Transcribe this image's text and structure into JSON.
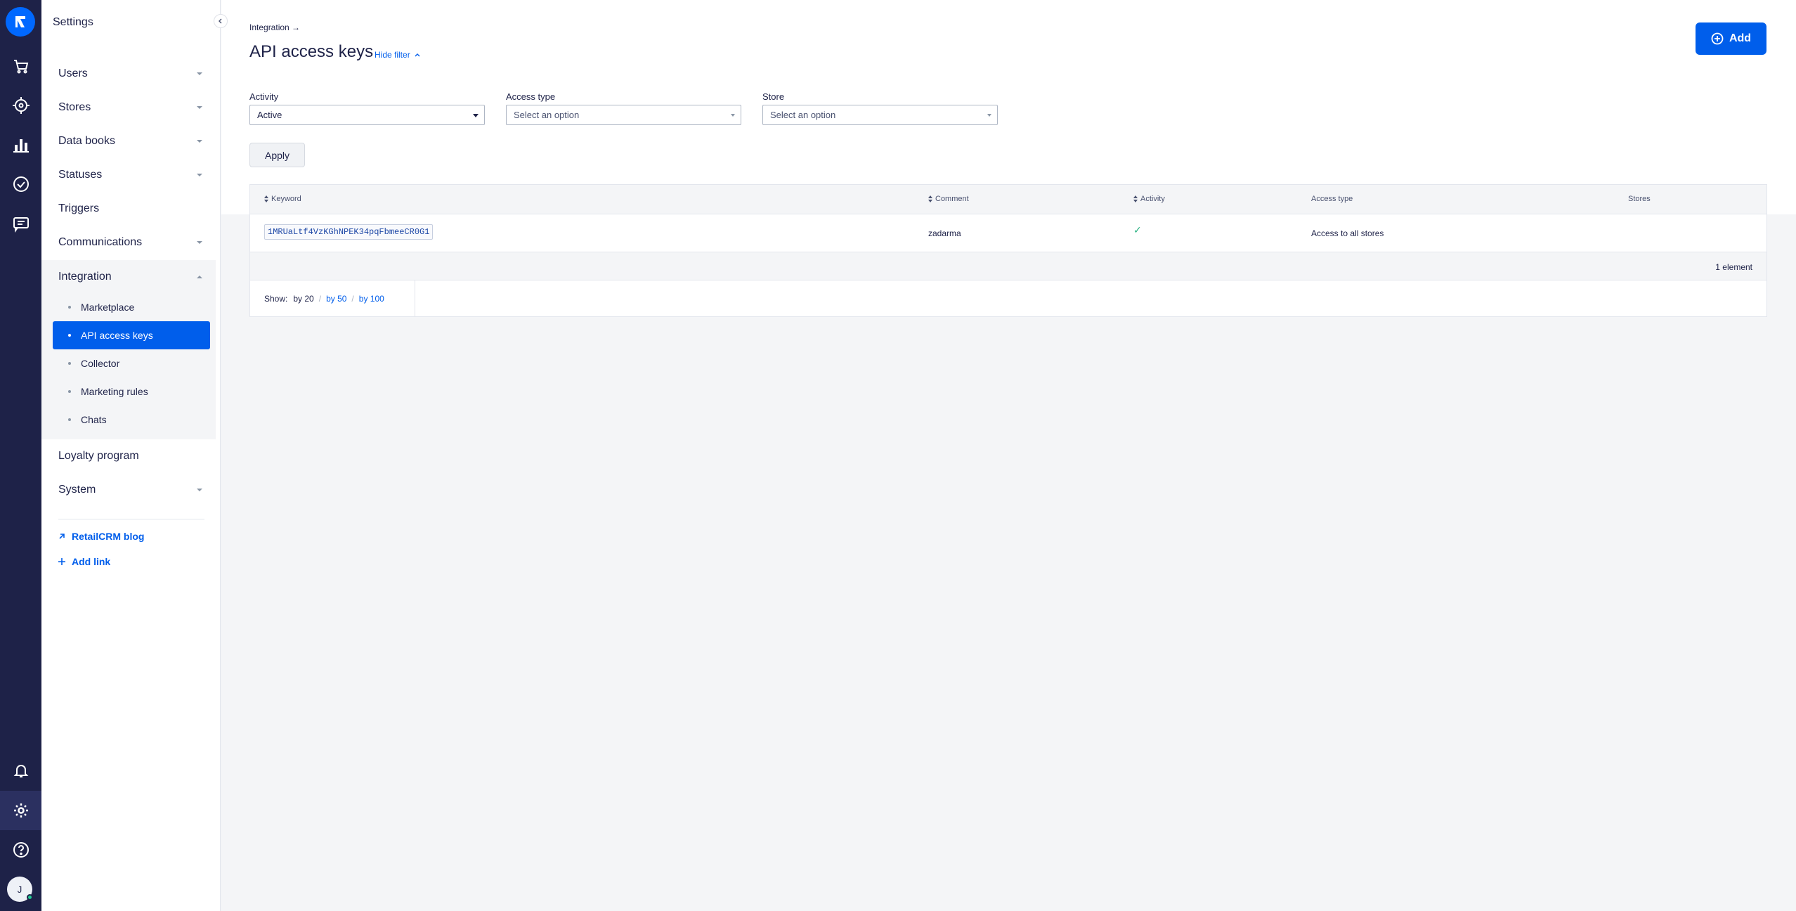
{
  "rail": {
    "items": [
      {
        "icon": "logo-icon"
      },
      {
        "icon": "cart-icon"
      },
      {
        "icon": "target-icon"
      },
      {
        "icon": "analytics-icon"
      },
      {
        "icon": "tasks-icon"
      },
      {
        "icon": "chats-icon"
      },
      {
        "icon": "bell-icon"
      },
      {
        "icon": "gear-icon"
      },
      {
        "icon": "help-icon"
      }
    ],
    "avatar_initial": "J"
  },
  "sidebar": {
    "title": "Settings",
    "items": [
      {
        "label": "Users"
      },
      {
        "label": "Stores"
      },
      {
        "label": "Data books"
      },
      {
        "label": "Statuses"
      },
      {
        "label": "Triggers"
      },
      {
        "label": "Communications"
      },
      {
        "label": "Integration"
      },
      {
        "label": "Loyalty program"
      },
      {
        "label": "System"
      }
    ],
    "integration_subitems": [
      {
        "label": "Marketplace"
      },
      {
        "label": "API access keys"
      },
      {
        "label": "Collector"
      },
      {
        "label": "Marketing rules"
      },
      {
        "label": "Chats"
      }
    ],
    "links": {
      "blog": "RetailCRM blog",
      "add_link": "Add link"
    }
  },
  "header": {
    "breadcrumb": "Integration →",
    "title": "API access keys",
    "hide_filter": "Hide filter",
    "add_button": "Add"
  },
  "filters": {
    "activity": {
      "label": "Activity",
      "value": "Active"
    },
    "access_type": {
      "label": "Access type",
      "placeholder": "Select an option"
    },
    "store": {
      "label": "Store",
      "placeholder": "Select an option"
    },
    "apply": "Apply"
  },
  "table": {
    "columns": [
      "Keyword",
      "Comment",
      "Activity",
      "Access type",
      "Stores"
    ],
    "rows": [
      {
        "keyword": "1MRUaLtf4VzKGhNPEK34pqFbmeeCR0G1",
        "comment": "zadarma",
        "activity": "✓",
        "access_type": "Access to all stores",
        "stores": ""
      }
    ],
    "count": "1 element",
    "pager": {
      "show": "Show:",
      "by20": "by 20",
      "by50": "by 50",
      "by100": "by 100"
    }
  },
  "colors": {
    "rail": "#1e2248",
    "accent": "#005eeb",
    "text": "#1e2248"
  }
}
